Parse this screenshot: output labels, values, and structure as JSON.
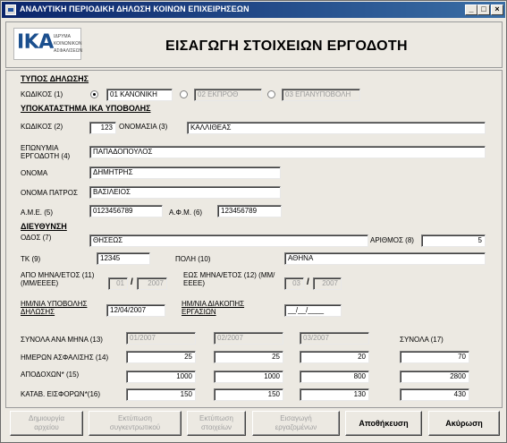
{
  "window": {
    "title": "ΑΝΑΛΥΤΙΚΗ ΠΕΡΙΟΔΙΚΗ ΔΗΛΩΣΗ ΚΟΙΝΩΝ ΕΠΙΧΕΙΡΗΣΕΩΝ",
    "minimize": "_",
    "maximize": "□",
    "close": "×"
  },
  "header": {
    "logo_text": "ΙΚΑ",
    "logo_sub_1": "ΙΔΡΥΜΑ",
    "logo_sub_2": "ΚΟΙΝΩΝΙΚΩΝ",
    "logo_sub_3": "ΑΣΦΑΛΙΣΕΩΝ",
    "title": "ΕΙΣΑΓΩΓΗ ΣΤΟΙΧΕΙΩΝ ΕΡΓΟΔΟΤΗ"
  },
  "declaration_type": {
    "section": "ΤΥΠΟΣ ΔΗΛΩΣΗΣ",
    "code_label": "ΚΩΔΙΚΟΣ (1)",
    "options": [
      "01 ΚΑΝΟΝΙΚΗ",
      "02 ΕΚΠΡΟΘ",
      "03 ΕΠΑΝΥΠΟΒΟΛΗ"
    ],
    "selected": "01 ΚΑΝΟΝΙΚΗ"
  },
  "branch": {
    "section": "ΥΠΟΚΑΤΑΣΤΗΜΑ ΙΚΑ ΥΠΟΒΟΛΗΣ",
    "code_label": "ΚΩΔΙΚΟΣ (2)",
    "code_value": "123",
    "name_label": "ΟΝΟΜΑΣΙΑ (3)",
    "name_value": "ΚΑΛΛΙΘΕΑΣ"
  },
  "employer": {
    "surname_label": "ΕΠΩΝΥΜΙΑ ΕΡΓΟΔΟΤΗ (4)",
    "surname_value": "ΠΑΠΑΔΟΠΟΥΛΟΣ",
    "first_name_label": "ΟΝΟΜΑ",
    "first_name_value": "ΔΗΜΗΤΡΗΣ",
    "father_name_label": "ΟΝΟΜΑ ΠΑΤΡΟΣ",
    "father_name_value": "ΒΑΣΙΛΕΙΟΣ",
    "ame_label": "Α.Μ.Ε. (5)",
    "ame_value": "0123456789",
    "afm_label": "Α.Φ.Μ. (6)",
    "afm_value": "123456789"
  },
  "address": {
    "section": "ΔΙΕΥΘΥΝΣΗ",
    "street_label": "ΟΔΟΣ (7)",
    "street_value": "ΘΗΣΕΩΣ",
    "number_label": "ΑΡΙΘΜΟΣ (8)",
    "number_value": "5",
    "zip_label": "ΤΚ (9)",
    "zip_value": "12345",
    "city_label": "ΠΟΛΗ (10)",
    "city_value": "ΑΘΗΝΑ"
  },
  "period": {
    "from_label": "ΑΠΟ ΜΗΝΑ/ΕΤΟΣ (11) (ΜΜ/ΕΕΕΕ)",
    "from_month": "01",
    "from_year": "2007",
    "to_label": "ΕΩΣ ΜΗΝΑ/ΕΤΟΣ (12) (ΜΜ/ΕΕΕΕ)",
    "to_month": "03",
    "to_year": "2007",
    "submit_date_label": "ΗΜ/ΝΙΑ ΥΠΟΒΟΛΗΣ ΔΗΛΩΣΗΣ",
    "submit_date_value": "12/04/2007",
    "termination_label": "ΗΜ/ΝΙΑ ΔΙΑΚΟΠΗΣ ΕΡΓΑΣΙΩΝ",
    "termination_value": "__/__/____"
  },
  "totals": {
    "per_month_label": "ΣΥΝΟΛΑ ΑΝΑ ΜΗΝΑ (13)",
    "months": [
      "01/2007",
      "02/2007",
      "03/2007"
    ],
    "total_label": "ΣΥΝΟΛΑ (17)",
    "rows": [
      {
        "label": "ΗΜΕΡΩΝ ΑΣΦΑΛΙΣΗΣ (14)",
        "values": [
          "25",
          "25",
          "20"
        ],
        "total": "70"
      },
      {
        "label": "ΑΠΟΔΟΧΩΝ* (15)",
        "values": [
          "1000",
          "1000",
          "800"
        ],
        "total": "2800"
      },
      {
        "label": "ΚΑΤΑΒ. ΕΙΣΦΟΡΩΝ*(16)",
        "values": [
          "150",
          "150",
          "130"
        ],
        "total": "430"
      }
    ]
  },
  "buttons": {
    "create_file": "Δημιουργία\nαρχείου",
    "print_summary": "Εκτύπωση\nσυγκεντρωτικού",
    "print_data": "Εκτύπωση\nστοιχείων",
    "import_data": "Εισαγωγή\nεργαζομένων",
    "save": "Αποθήκευση",
    "cancel": "Ακύρωση"
  }
}
